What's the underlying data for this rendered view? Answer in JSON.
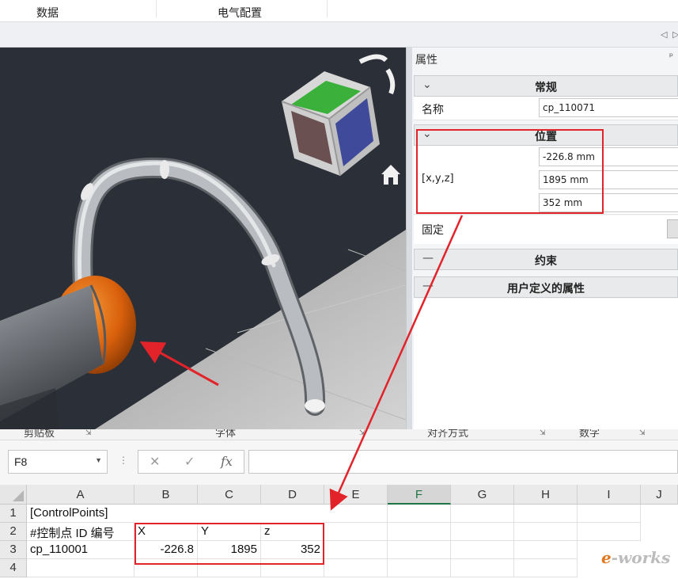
{
  "tabs": [
    "数据",
    "电气配置"
  ],
  "nav": {
    "prev": "◁",
    "next": "▷"
  },
  "properties": {
    "title": "属性",
    "pin": "ᵖ",
    "sections": {
      "general": {
        "label": "常规",
        "chevron": "⌄"
      },
      "position": {
        "label": "位置",
        "chevron": "⌄"
      },
      "constraint": {
        "label": "约束",
        "chevron": "—"
      },
      "custom": {
        "label": "用户定义的属性",
        "chevron": "—"
      }
    },
    "name_label": "名称",
    "name_value": "cp_110071",
    "xyz_label": "[x,y,z]",
    "x_value": "-226.8 mm",
    "y_value": "1895 mm",
    "z_value": "352 mm",
    "fixed_label": "固定"
  },
  "viewcube": {
    "home_icon": "home-icon",
    "rotate_icon": "rotate-icon"
  },
  "excel": {
    "ribbon_groups": [
      "剪贴板",
      "字体",
      "对齐方式",
      "数字"
    ],
    "name_box": "F8",
    "formula_buttons": {
      "cancel": "✕",
      "enter": "✓",
      "fx": "fx"
    },
    "columns": [
      "A",
      "B",
      "C",
      "D",
      "E",
      "F",
      "G",
      "H",
      "I",
      "J"
    ],
    "selected_column": "F",
    "rows": [
      {
        "num": "1",
        "cells": [
          "[ControlPoints]",
          "",
          "",
          ""
        ]
      },
      {
        "num": "2",
        "cells": [
          "#控制点 ID 编号",
          "X",
          "Y",
          "z"
        ]
      },
      {
        "num": "3",
        "cells": [
          "cp_110001",
          "-226.8",
          "1895",
          "352"
        ]
      },
      {
        "num": "4",
        "cells": [
          "",
          "",
          "",
          ""
        ]
      }
    ]
  },
  "watermark": {
    "prefix": "e",
    "rest": "-works"
  },
  "colors": {
    "annotation_red": "#e3232a",
    "viewport_bg": "#2b2f37",
    "pipe_orange": "#e06a10",
    "excel_green": "#217346"
  }
}
